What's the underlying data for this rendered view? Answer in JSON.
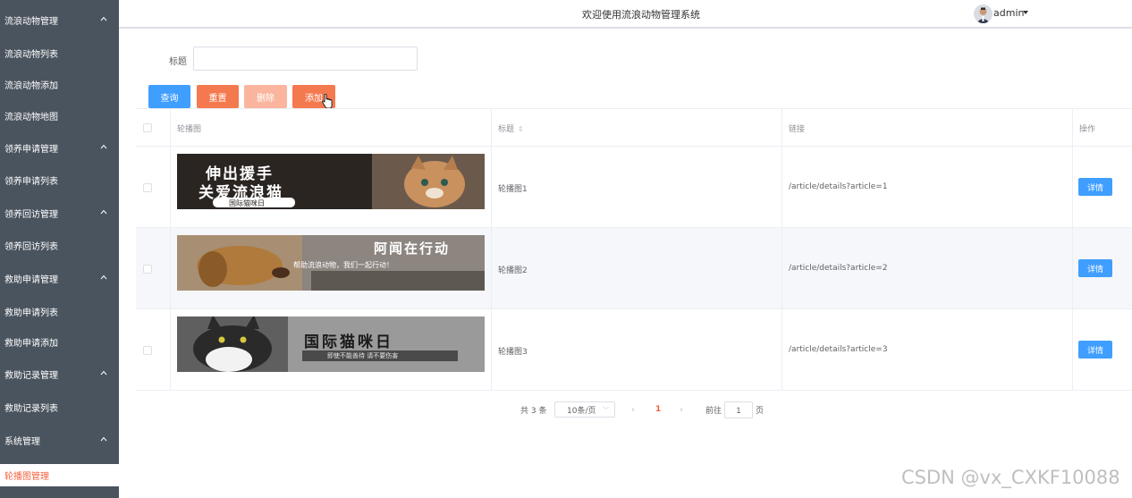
{
  "sidebar": {
    "items": [
      {
        "label": "流浪动物管理",
        "type": "group"
      },
      {
        "label": "流浪动物列表",
        "type": "item"
      },
      {
        "label": "流浪动物添加",
        "type": "item"
      },
      {
        "label": "流浪动物地图",
        "type": "item"
      },
      {
        "label": "领养申请管理",
        "type": "group"
      },
      {
        "label": "领养申请列表",
        "type": "item"
      },
      {
        "label": "领养回访管理",
        "type": "group"
      },
      {
        "label": "领养回访列表",
        "type": "item"
      },
      {
        "label": "救助申请管理",
        "type": "group"
      },
      {
        "label": "救助申请列表",
        "type": "item"
      },
      {
        "label": "救助申请添加",
        "type": "item"
      },
      {
        "label": "救助记录管理",
        "type": "group"
      },
      {
        "label": "救助记录列表",
        "type": "item"
      },
      {
        "label": "系统管理",
        "type": "group"
      },
      {
        "label": "轮播图管理",
        "type": "item",
        "active": true
      }
    ]
  },
  "header": {
    "title": "欢迎使用流浪动物管理系统",
    "user": "admin"
  },
  "search": {
    "label": "标题",
    "value": "",
    "placeholder": ""
  },
  "toolbar": {
    "query": "查询",
    "reset": "重置",
    "delete": "删除",
    "add": "添加"
  },
  "table": {
    "columns": {
      "image": "轮播图",
      "title": "标题",
      "link": "链接",
      "action": "操作"
    },
    "rows": [
      {
        "title": "轮播图1",
        "link": "/article/details?article=1",
        "action": "详情",
        "banner_text": [
          "伸出援手",
          "关爱流浪猫",
          "国际猫咪日"
        ]
      },
      {
        "title": "轮播图2",
        "link": "/article/details?article=2",
        "action": "详情",
        "banner_text": [
          "阿闻在行动",
          "帮助流浪动物，我们一起行动！"
        ]
      },
      {
        "title": "轮播图3",
        "link": "/article/details?article=3",
        "action": "详情",
        "banner_text": [
          "国际猫咪日",
          "即使不能善待 请不要伤害"
        ]
      }
    ]
  },
  "pagination": {
    "total": "共 3 条",
    "page_size": "10条/页",
    "current": "1",
    "goto_label": "前往",
    "goto_value": "1",
    "page_suffix": "页"
  },
  "watermark": "CSDN @vx_CXKF10088",
  "colors": {
    "sidebar_bg": "#4a545f",
    "accent": "#f5613b",
    "primary": "#409eff",
    "danger_soft": "#fbb59e"
  }
}
